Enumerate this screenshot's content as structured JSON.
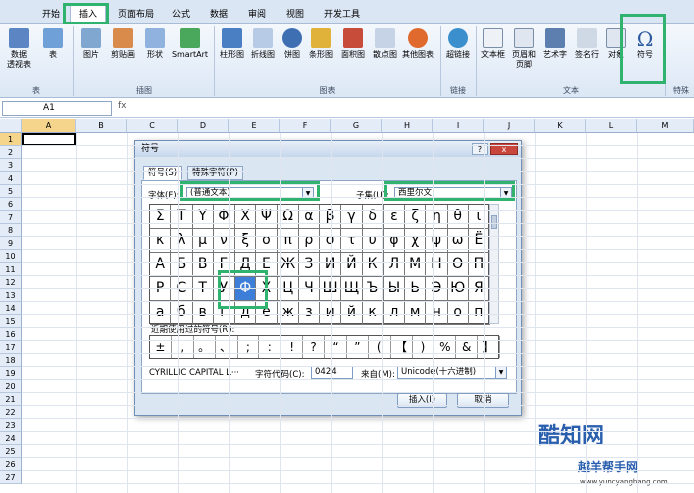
{
  "ribbon_tabs": [
    "开始",
    "插入",
    "页面布局",
    "公式",
    "数据",
    "审阅",
    "视图",
    "开发工具"
  ],
  "ribbon_groups": {
    "table": {
      "name": "表",
      "buttons": [
        "数据\n透视表",
        "表"
      ]
    },
    "illustrations": {
      "name": "插图",
      "buttons": [
        "图片",
        "剪贴画",
        "形状",
        "SmartArt"
      ]
    },
    "charts": {
      "name": "图表",
      "buttons": [
        "柱形图",
        "折线图",
        "饼图",
        "条形图",
        "面积图",
        "散点图",
        "其他图表"
      ]
    },
    "links": {
      "name": "链接",
      "buttons": [
        "超链接"
      ]
    },
    "text": {
      "name": "文本",
      "buttons": [
        "文本框",
        "页眉和\n页脚",
        "艺术字",
        "签名行",
        "对象",
        "符号"
      ]
    },
    "special": {
      "name": "特殊"
    }
  },
  "formula_bar": {
    "name_box": "A1",
    "fx": "fx"
  },
  "columns": [
    "A",
    "B",
    "C",
    "D",
    "E",
    "F",
    "G",
    "H",
    "I",
    "J",
    "K",
    "L",
    "M"
  ],
  "rows": [
    "1",
    "2",
    "3",
    "4",
    "5",
    "6",
    "7",
    "8",
    "9",
    "10",
    "11",
    "12",
    "13",
    "14",
    "15",
    "16",
    "17",
    "18",
    "19",
    "20",
    "21",
    "22",
    "23",
    "24",
    "25",
    "26",
    "27"
  ],
  "dialog": {
    "title": "符号",
    "tabs": [
      "符号(S)",
      "特殊字符(P)"
    ],
    "font_label": "字体(F):",
    "font_value": "(普通文本)",
    "subset_label": "子集(U):",
    "subset_value": "西里尔文",
    "grid_rows": [
      [
        "Σ",
        "Τ",
        "Υ",
        "Φ",
        "Χ",
        "Ψ",
        "Ω",
        "α",
        "β",
        "γ",
        "δ",
        "ε",
        "ζ",
        "η",
        "θ",
        "ι"
      ],
      [
        "κ",
        "λ",
        "μ",
        "ν",
        "ξ",
        "ο",
        "π",
        "ρ",
        "σ",
        "τ",
        "υ",
        "φ",
        "χ",
        "ψ",
        "ω",
        "Ё"
      ],
      [
        "А",
        "Б",
        "В",
        "Г",
        "Д",
        "Е",
        "Ж",
        "З",
        "И",
        "Й",
        "К",
        "Л",
        "М",
        "Н",
        "О",
        "П"
      ],
      [
        "Р",
        "С",
        "Т",
        "У",
        "Ф",
        "Х",
        "Ц",
        "Ч",
        "Ш",
        "Щ",
        "Ъ",
        "Ы",
        "Ь",
        "Э",
        "Ю",
        "Я"
      ],
      [
        "а",
        "б",
        "в",
        "г",
        "д",
        "е",
        "ж",
        "з",
        "и",
        "й",
        "к",
        "л",
        "м",
        "н",
        "о",
        "п"
      ]
    ],
    "selected_symbol": "Ф",
    "recent_label": "近期使用过的符号(R):",
    "recent_symbols": [
      "±",
      ",",
      "。",
      "、",
      ";",
      ":",
      "!",
      "?",
      "“",
      "”",
      "(",
      "【",
      ")",
      "%",
      "&",
      "】"
    ],
    "char_name": "CYRILLIC CAPITAL L···",
    "char_code_label": "字符代码(C):",
    "char_code_value": "0424",
    "from_label": "来自(M):",
    "from_value": "Unicode(十六进制)",
    "insert_button": "插入(I)",
    "cancel_button": "取消",
    "help": "?",
    "close": "x"
  },
  "watermark": {
    "brand": "酷知网",
    "site": "www.yuncyangbang.com",
    "sub": "越羊帮手网"
  },
  "colors": {
    "highlight": "#2fb36f",
    "selected": "#3d7fd8"
  }
}
